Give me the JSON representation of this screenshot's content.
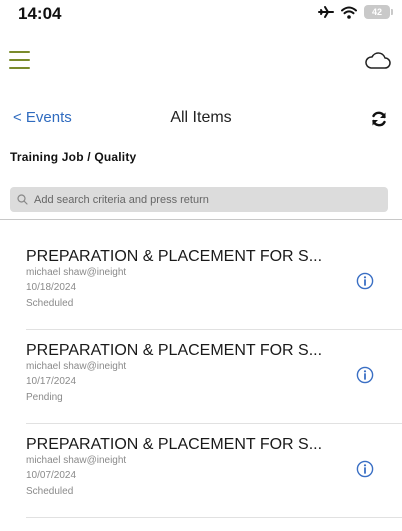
{
  "status_bar": {
    "time": "14:04",
    "battery": "42"
  },
  "nav": {
    "back_label": "< Events",
    "title": "All Items"
  },
  "subtitle": "Training Job / Quality",
  "search": {
    "placeholder": "Add search criteria and press return"
  },
  "items": [
    {
      "title": "PREPARATION & PLACEMENT FOR S...",
      "user": "michael shaw@ineight",
      "date": "10/18/2024",
      "status": "Scheduled"
    },
    {
      "title": "PREPARATION & PLACEMENT FOR S...",
      "user": "michael shaw@ineight",
      "date": "10/17/2024",
      "status": "Pending"
    },
    {
      "title": "PREPARATION & PLACEMENT FOR S...",
      "user": "michael shaw@ineight",
      "date": "10/07/2024",
      "status": "Scheduled"
    }
  ],
  "colors": {
    "accent": "#7a8b2c",
    "link": "#2f6bbf",
    "info": "#3a6fc4"
  }
}
